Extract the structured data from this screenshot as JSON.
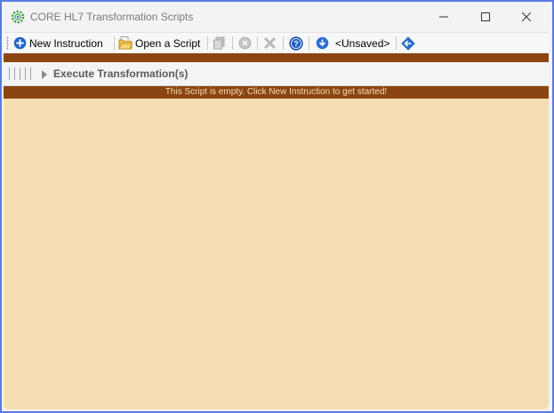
{
  "window": {
    "title": "CORE HL7 Transformation Scripts"
  },
  "toolbar": {
    "new_instruction_label": "New Instruction",
    "open_script_label": "Open a Script",
    "script_name": "<Unsaved>"
  },
  "execute_bar": {
    "label": "Execute Transformation(s)"
  },
  "banner": {
    "text": "This Script is empty. Click New Instruction to get started!"
  },
  "colors": {
    "accent": "#8b4513",
    "canvas": "#f5deb3",
    "window_border": "#5b79e0"
  },
  "icons": [
    "app-gear-icon",
    "minimize-icon",
    "maximize-icon",
    "close-icon",
    "add-circle-icon",
    "open-folder-icon",
    "copy-icon",
    "disabled-circle-icon",
    "delete-x-icon",
    "help-icon",
    "save-down-arrow-icon",
    "load-arrow-icon",
    "expand-arrow-icon"
  ]
}
